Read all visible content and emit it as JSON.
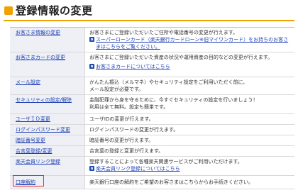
{
  "header": {
    "title": "登録情報の変更",
    "accent_color": "#f0a000"
  },
  "rows": [
    {
      "label": "お客さま情報の変更",
      "desc": [
        "お客さまにご登録いただいたご住所や電話番号の変更が行えます。"
      ],
      "links": [
        "スーパーローンカード（楽天銀行カードローン※旧マイワンカード）をお持ちのお客さまはこちらをご覧ください。"
      ]
    },
    {
      "label": "お客さまカードの変更",
      "desc": [
        "お客さまにご登録いただいた資産の状況や運用資産の目的などの変更が行えます。"
      ],
      "links": [
        "お客さまカードについてはこちら"
      ]
    },
    {
      "label": "メール設定",
      "desc": [
        "かんたん振込（メルマネ）やセキュリティ設定をご利用いただく前に、",
        "メール設定が必要です。"
      ],
      "links": []
    },
    {
      "label": "セキュリティの設定/解除",
      "desc": [
        "金融犯罪から身を守るために、今すぐセキュリティの設定を行いましょう！",
        "利用は全て無料。設定も簡単です。"
      ],
      "links": []
    },
    {
      "label": "ユーザＩＤ変更",
      "desc": [
        "ユーザIDの変更が行えます。"
      ],
      "links": []
    },
    {
      "label": "ログインパスワード変更",
      "desc": [
        "ログインパスワードの変更が行えます。"
      ],
      "links": []
    },
    {
      "label": "暗証番号変更",
      "desc": [
        "暗証番号の変更が行えます。"
      ],
      "links": []
    },
    {
      "label": "合言葉登録/変更",
      "desc": [
        "合言葉の登録と変更が行えます。"
      ],
      "links": []
    },
    {
      "label": "楽天会員リンク登録",
      "desc": [
        "登録することによって各種楽天関連サービスがご利用いただけます。"
      ],
      "links": [
        "楽天会員リンク登録についてはこちら"
      ]
    },
    {
      "label": "口座解約",
      "desc": [
        "楽天銀行口座の解約をご希望のお客さまはこちらからお手続きください。"
      ],
      "links": []
    }
  ]
}
